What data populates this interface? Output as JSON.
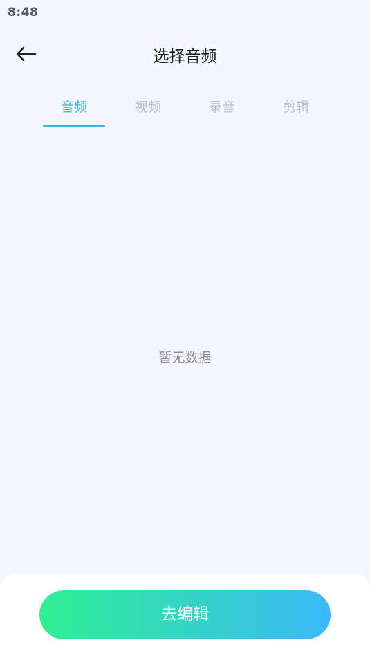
{
  "status_bar": {
    "time": "8:48"
  },
  "header": {
    "title": "选择音频",
    "back_icon": "arrow-left-icon"
  },
  "tabs": [
    {
      "label": "音频",
      "active": true
    },
    {
      "label": "视频",
      "active": false
    },
    {
      "label": "录音",
      "active": false
    },
    {
      "label": "剪辑",
      "active": false
    }
  ],
  "content": {
    "empty_text": "暂无数据"
  },
  "footer": {
    "edit_button_label": "去编辑"
  },
  "colors": {
    "accent": "#3bb5f0",
    "background": "#f4f7fe",
    "button_gradient_start": "#2ff093",
    "button_gradient_end": "#3ab9f8"
  }
}
